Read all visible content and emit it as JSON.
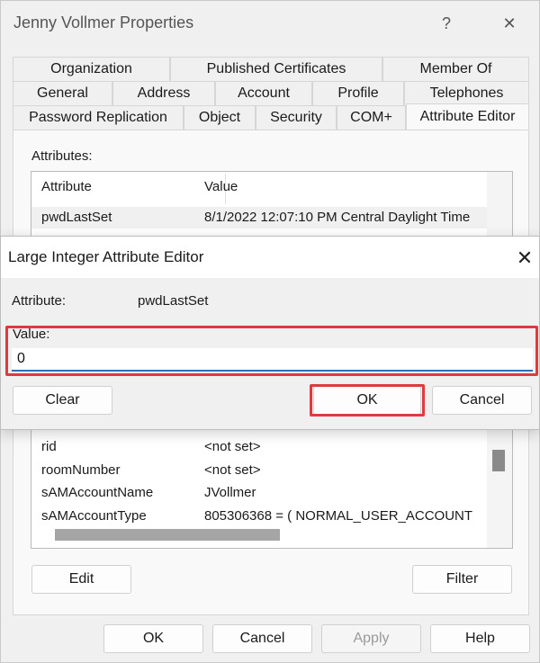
{
  "window": {
    "title": "Jenny Vollmer Properties",
    "help_glyph": "?",
    "close_glyph": "✕"
  },
  "tabs": {
    "row1": [
      "Organization",
      "Published Certificates",
      "Member Of"
    ],
    "row2": [
      "General",
      "Address",
      "Account",
      "Profile",
      "Telephones"
    ],
    "row3": [
      "Password Replication",
      "Object",
      "Security",
      "COM+",
      "Attribute Editor"
    ],
    "active": "Attribute Editor"
  },
  "attribute_editor": {
    "attributes_label": "Attributes:",
    "columns": [
      "Attribute",
      "Value"
    ],
    "rows_top": [
      {
        "attribute": "pwdLastSet",
        "value": "8/1/2022 12:07:10 PM Central Daylight Time"
      }
    ],
    "rows_bottom": [
      {
        "attribute": "rid",
        "value": "<not set>"
      },
      {
        "attribute": "roomNumber",
        "value": "<not set>"
      },
      {
        "attribute": "sAMAccountName",
        "value": "JVollmer"
      },
      {
        "attribute": "sAMAccountType",
        "value": "805306368 = ( NORMAL_USER_ACCOUNT"
      }
    ],
    "edit_label": "Edit",
    "filter_label": "Filter"
  },
  "footer": {
    "ok_label": "OK",
    "cancel_label": "Cancel",
    "apply_label": "Apply",
    "help_label": "Help"
  },
  "dialog": {
    "title": "Large Integer Attribute Editor",
    "close_glyph": "✕",
    "attribute_label": "Attribute:",
    "attribute_value": "pwdLastSet",
    "value_label": "Value:",
    "value": "0",
    "clear_label": "Clear",
    "ok_label": "OK",
    "cancel_label": "Cancel"
  },
  "colors": {
    "highlight_red": "#e0393e",
    "input_underline": "#2f6fb8"
  }
}
